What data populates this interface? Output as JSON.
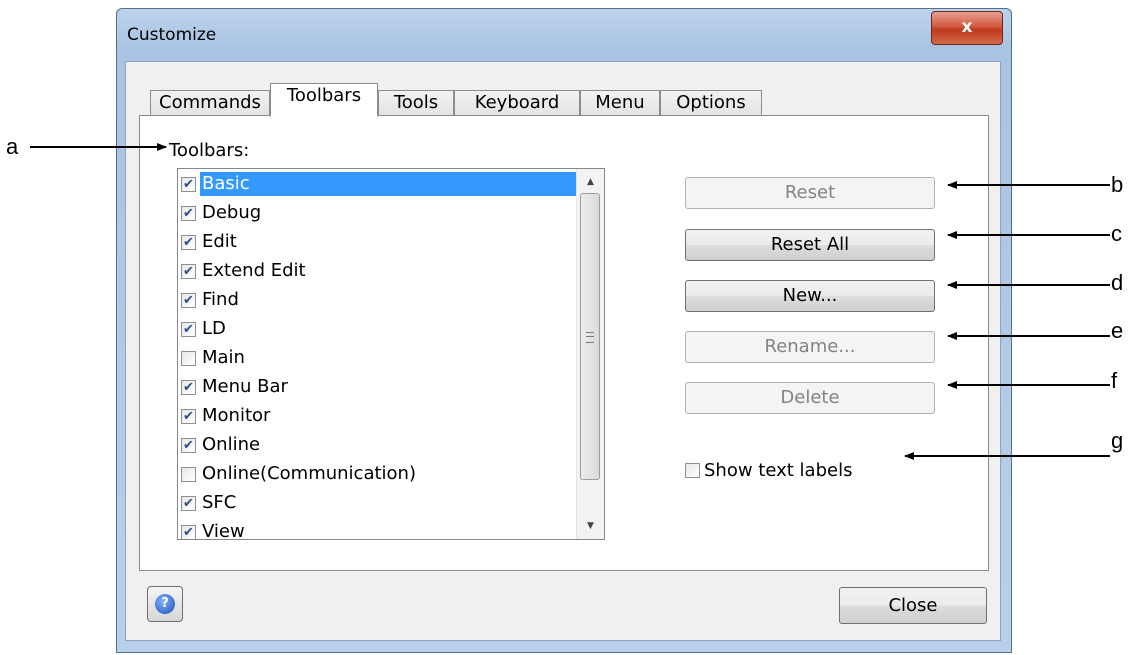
{
  "window": {
    "title": "Customize",
    "close_glyph": "x"
  },
  "tabs": [
    {
      "label": "Commands",
      "active": false
    },
    {
      "label": "Toolbars",
      "active": true
    },
    {
      "label": "Tools",
      "active": false
    },
    {
      "label": "Keyboard",
      "active": false
    },
    {
      "label": "Menu",
      "active": false
    },
    {
      "label": "Options",
      "active": false
    }
  ],
  "toolbars_panel": {
    "label": "Toolbars:",
    "items": [
      {
        "label": "Basic",
        "checked": true,
        "selected": true
      },
      {
        "label": "Debug",
        "checked": true,
        "selected": false
      },
      {
        "label": "Edit",
        "checked": true,
        "selected": false
      },
      {
        "label": "Extend Edit",
        "checked": true,
        "selected": false
      },
      {
        "label": "Find",
        "checked": true,
        "selected": false
      },
      {
        "label": "LD",
        "checked": true,
        "selected": false
      },
      {
        "label": "Main",
        "checked": false,
        "selected": false
      },
      {
        "label": "Menu Bar",
        "checked": true,
        "selected": false
      },
      {
        "label": "Monitor",
        "checked": true,
        "selected": false
      },
      {
        "label": "Online",
        "checked": true,
        "selected": false
      },
      {
        "label": "Online(Communication)",
        "checked": false,
        "selected": false
      },
      {
        "label": "SFC",
        "checked": true,
        "selected": false
      },
      {
        "label": "View",
        "checked": true,
        "selected": false
      }
    ],
    "buttons": {
      "reset": {
        "label": "Reset",
        "enabled": false
      },
      "reset_all": {
        "label": "Reset All",
        "enabled": true
      },
      "new": {
        "label": "New...",
        "enabled": true
      },
      "rename": {
        "label": "Rename...",
        "enabled": false
      },
      "delete": {
        "label": "Delete",
        "enabled": false
      }
    },
    "show_text_labels": {
      "label": "Show text labels",
      "checked": false
    }
  },
  "footer": {
    "help_icon": "help-icon",
    "close_label": "Close"
  },
  "annotations": {
    "a": "a",
    "b": "b",
    "c": "c",
    "d": "d",
    "e": "e",
    "f": "f",
    "g": "g"
  },
  "colors": {
    "selection": "#3399ff",
    "window_frame": "#a9c3e2",
    "close_button": "#c0391d",
    "disabled_text": "#838383"
  }
}
